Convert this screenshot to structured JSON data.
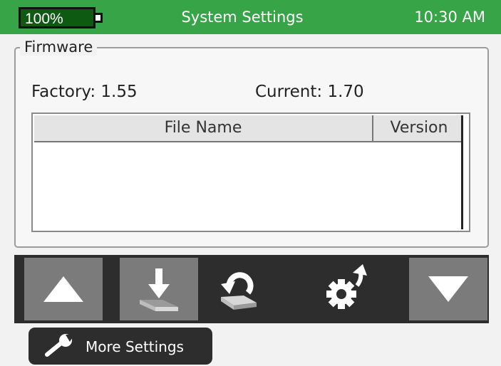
{
  "status": {
    "battery": "100%",
    "title": "System Settings",
    "time": "10:30 AM"
  },
  "firmware": {
    "legend": "Firmware",
    "factory": "Factory: 1.55",
    "current": "Current: 1.70",
    "table": {
      "headers": [
        "File Name",
        "Version"
      ],
      "rows": []
    }
  },
  "toolbar": {
    "buttons": [
      {
        "icon": "arrow-up-icon"
      },
      {
        "icon": "download-icon"
      },
      {
        "icon": "restore-icon"
      },
      {
        "icon": "settings-reset-icon"
      },
      {
        "icon": "arrow-down-icon"
      }
    ]
  },
  "more_settings": {
    "label": "More Settings",
    "icon": "wrench-icon"
  },
  "colors": {
    "status_bar": "#37a447",
    "battery_fill": "#0f5a12",
    "toolbar": "#2d2d2d",
    "button_light": "#7b7b7b"
  }
}
